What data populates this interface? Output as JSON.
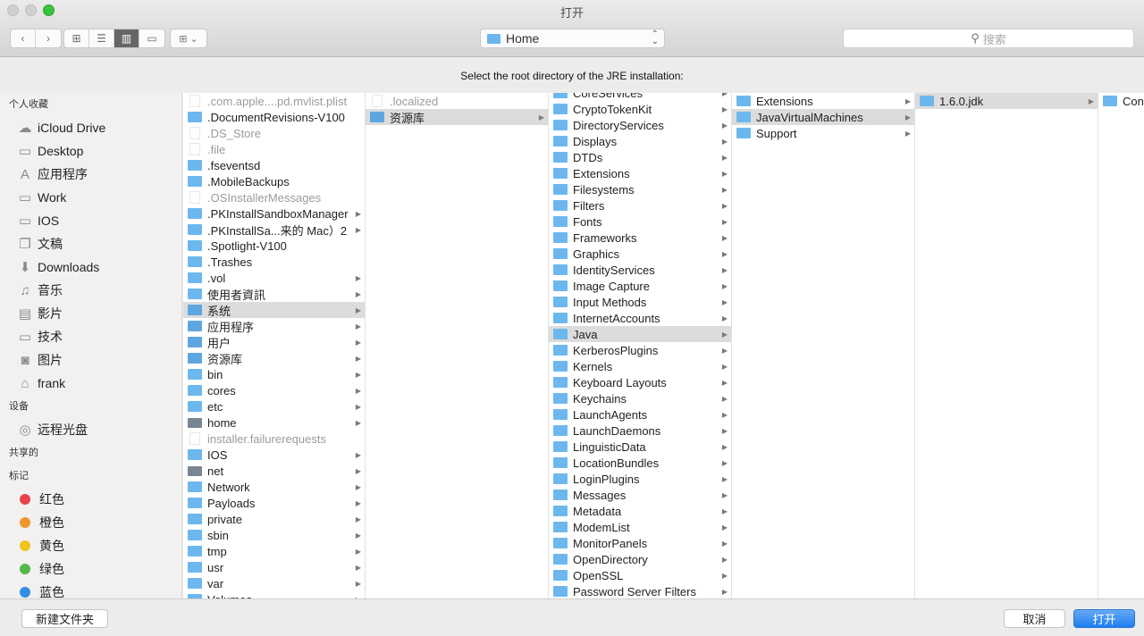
{
  "window": {
    "title": "打开"
  },
  "toolbar": {
    "back": "‹",
    "forward": "›",
    "view_modes": [
      {
        "name": "icon-view",
        "glyph": "⊞",
        "active": false
      },
      {
        "name": "list-view",
        "glyph": "☰",
        "active": false
      },
      {
        "name": "column-view",
        "glyph": "▥",
        "active": true
      },
      {
        "name": "coverflow-view",
        "glyph": "▭",
        "active": false
      }
    ],
    "arrange_glyph": "⊞ ⌄",
    "path_popup": "Home",
    "search_placeholder": "搜索"
  },
  "prompt": "Select the root directory of the JRE installation:",
  "sidebar": {
    "sections": [
      {
        "header": "个人收藏",
        "items": [
          {
            "label": "iCloud Drive",
            "icon": "cloud-icon",
            "glyph": "☁"
          },
          {
            "label": "Desktop",
            "icon": "desktop-icon",
            "glyph": "▭"
          },
          {
            "label": "应用程序",
            "icon": "applications-icon",
            "glyph": "A"
          },
          {
            "label": "Work",
            "icon": "folder-icon",
            "glyph": "▭"
          },
          {
            "label": "IOS",
            "icon": "folder-icon",
            "glyph": "▭"
          },
          {
            "label": "文稿",
            "icon": "documents-icon",
            "glyph": "❐"
          },
          {
            "label": "Downloads",
            "icon": "downloads-icon",
            "glyph": "⬇"
          },
          {
            "label": "音乐",
            "icon": "music-icon",
            "glyph": "♫"
          },
          {
            "label": "影片",
            "icon": "movies-icon",
            "glyph": "▤"
          },
          {
            "label": "技术",
            "icon": "folder-icon",
            "glyph": "▭"
          },
          {
            "label": "图片",
            "icon": "pictures-icon",
            "glyph": "◙"
          },
          {
            "label": "frank",
            "icon": "home-icon",
            "glyph": "⌂"
          }
        ]
      },
      {
        "header": "设备",
        "items": [
          {
            "label": "远程光盘",
            "icon": "disc-icon",
            "glyph": "◎"
          }
        ]
      },
      {
        "header": "共享的",
        "items": []
      },
      {
        "header": "标记",
        "items": [
          {
            "label": "红色",
            "icon": "tag-red-icon",
            "color": "#e8434a"
          },
          {
            "label": "橙色",
            "icon": "tag-orange-icon",
            "color": "#f0962c"
          },
          {
            "label": "黄色",
            "icon": "tag-yellow-icon",
            "color": "#f0c420"
          },
          {
            "label": "绿色",
            "icon": "tag-green-icon",
            "color": "#52b947"
          },
          {
            "label": "蓝色",
            "icon": "tag-blue-icon",
            "color": "#2f8ee6"
          }
        ]
      }
    ]
  },
  "columns": [
    {
      "items": [
        {
          "name": ".com.apple....pd.mvlist.plist",
          "type": "doc",
          "dim": true
        },
        {
          "name": ".DocumentRevisions-V100",
          "type": "folder"
        },
        {
          "name": ".DS_Store",
          "type": "doc",
          "dim": true
        },
        {
          "name": ".file",
          "type": "doc",
          "dim": true
        },
        {
          "name": ".fseventsd",
          "type": "folder"
        },
        {
          "name": ".MobileBackups",
          "type": "folder"
        },
        {
          "name": ".OSInstallerMessages",
          "type": "doc",
          "dim": true
        },
        {
          "name": ".PKInstallSandboxManager",
          "type": "folder",
          "arrow": true
        },
        {
          "name": ".PKInstallSa...来的 Mac）2",
          "type": "folder",
          "arrow": true
        },
        {
          "name": ".Spotlight-V100",
          "type": "folder"
        },
        {
          "name": ".Trashes",
          "type": "folder"
        },
        {
          "name": ".vol",
          "type": "folder",
          "arrow": true
        },
        {
          "name": "使用者資訊",
          "type": "folder",
          "arrow": true
        },
        {
          "name": "系统",
          "type": "app",
          "arrow": true,
          "selected": true
        },
        {
          "name": "应用程序",
          "type": "app",
          "arrow": true
        },
        {
          "name": "用户",
          "type": "app",
          "arrow": true
        },
        {
          "name": "资源库",
          "type": "app",
          "arrow": true
        },
        {
          "name": "bin",
          "type": "folder",
          "arrow": true
        },
        {
          "name": "cores",
          "type": "folder",
          "arrow": true
        },
        {
          "name": "etc",
          "type": "folder",
          "arrow": true
        },
        {
          "name": "home",
          "type": "drive",
          "arrow": true
        },
        {
          "name": "installer.failurerequests",
          "type": "doc",
          "dim": true
        },
        {
          "name": "IOS",
          "type": "folder",
          "arrow": true
        },
        {
          "name": "net",
          "type": "drive",
          "arrow": true
        },
        {
          "name": "Network",
          "type": "folder",
          "arrow": true
        },
        {
          "name": "Payloads",
          "type": "folder",
          "arrow": true
        },
        {
          "name": "private",
          "type": "folder",
          "arrow": true
        },
        {
          "name": "sbin",
          "type": "folder",
          "arrow": true
        },
        {
          "name": "tmp",
          "type": "folder",
          "arrow": true
        },
        {
          "name": "usr",
          "type": "folder",
          "arrow": true
        },
        {
          "name": "var",
          "type": "folder",
          "arrow": true
        },
        {
          "name": "Volumes",
          "type": "folder",
          "arrow": true
        }
      ]
    },
    {
      "items": [
        {
          "name": ".localized",
          "type": "doc",
          "dim": true
        },
        {
          "name": "资源库",
          "type": "app",
          "arrow": true,
          "selected": true
        }
      ]
    },
    {
      "items": [
        {
          "name": "CoreServices",
          "type": "folder",
          "arrow": true
        },
        {
          "name": "CryptoTokenKit",
          "type": "folder",
          "arrow": true
        },
        {
          "name": "DirectoryServices",
          "type": "folder",
          "arrow": true
        },
        {
          "name": "Displays",
          "type": "folder",
          "arrow": true
        },
        {
          "name": "DTDs",
          "type": "folder",
          "arrow": true
        },
        {
          "name": "Extensions",
          "type": "folder",
          "arrow": true
        },
        {
          "name": "Filesystems",
          "type": "folder",
          "arrow": true
        },
        {
          "name": "Filters",
          "type": "folder",
          "arrow": true
        },
        {
          "name": "Fonts",
          "type": "folder",
          "arrow": true
        },
        {
          "name": "Frameworks",
          "type": "folder",
          "arrow": true
        },
        {
          "name": "Graphics",
          "type": "folder",
          "arrow": true
        },
        {
          "name": "IdentityServices",
          "type": "folder",
          "arrow": true
        },
        {
          "name": "Image Capture",
          "type": "folder",
          "arrow": true
        },
        {
          "name": "Input Methods",
          "type": "folder",
          "arrow": true
        },
        {
          "name": "InternetAccounts",
          "type": "folder",
          "arrow": true
        },
        {
          "name": "Java",
          "type": "folder",
          "arrow": true,
          "selected": true
        },
        {
          "name": "KerberosPlugins",
          "type": "folder",
          "arrow": true
        },
        {
          "name": "Kernels",
          "type": "folder",
          "arrow": true
        },
        {
          "name": "Keyboard Layouts",
          "type": "folder",
          "arrow": true
        },
        {
          "name": "Keychains",
          "type": "folder",
          "arrow": true
        },
        {
          "name": "LaunchAgents",
          "type": "folder",
          "arrow": true
        },
        {
          "name": "LaunchDaemons",
          "type": "folder",
          "arrow": true
        },
        {
          "name": "LinguisticData",
          "type": "folder",
          "arrow": true
        },
        {
          "name": "LocationBundles",
          "type": "folder",
          "arrow": true
        },
        {
          "name": "LoginPlugins",
          "type": "folder",
          "arrow": true
        },
        {
          "name": "Messages",
          "type": "folder",
          "arrow": true
        },
        {
          "name": "Metadata",
          "type": "folder",
          "arrow": true
        },
        {
          "name": "ModemList",
          "type": "folder",
          "arrow": true
        },
        {
          "name": "MonitorPanels",
          "type": "folder",
          "arrow": true
        },
        {
          "name": "OpenDirectory",
          "type": "folder",
          "arrow": true
        },
        {
          "name": "OpenSSL",
          "type": "folder",
          "arrow": true
        },
        {
          "name": "Password Server Filters",
          "type": "folder",
          "arrow": true
        }
      ]
    },
    {
      "items": [
        {
          "name": "Extensions",
          "type": "folder",
          "arrow": true
        },
        {
          "name": "JavaVirtualMachines",
          "type": "folder",
          "arrow": true,
          "selected": true
        },
        {
          "name": "Support",
          "type": "folder",
          "arrow": true
        }
      ]
    },
    {
      "items": [
        {
          "name": "1.6.0.jdk",
          "type": "folder",
          "arrow": true,
          "selected": true
        }
      ]
    },
    {
      "items": [
        {
          "name": "Contents",
          "type": "folder"
        }
      ]
    }
  ],
  "footer": {
    "new_folder": "新建文件夹",
    "cancel": "取消",
    "open": "打开"
  }
}
